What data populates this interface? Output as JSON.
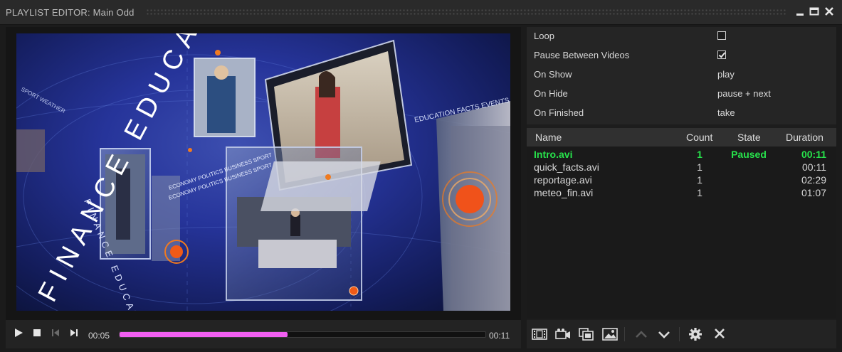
{
  "window": {
    "title": "PLAYLIST EDITOR: Main Odd"
  },
  "video": {
    "overlay_texts": {
      "finance_education": "FINANCE EDUCATION",
      "finance_education_small": "FINANCE EDUCATION F",
      "economy_politics": "ECONOMY POLITICS BUSINESS SPORT",
      "education_facts": "EDUCATION FACTS EVENTS PEOPLE",
      "sport_weather": "SPORT WEATHER"
    }
  },
  "transport": {
    "current_time": "00:05",
    "total_time": "00:11",
    "progress_fraction": 0.46,
    "accent_color": "#f15ff1"
  },
  "properties": [
    {
      "label": "Loop",
      "type": "checkbox",
      "checked": false
    },
    {
      "label": "Pause Between Videos",
      "type": "checkbox",
      "checked": true
    },
    {
      "label": "On Show",
      "type": "text",
      "value": "play"
    },
    {
      "label": "On Hide",
      "type": "text",
      "value": "pause + next"
    },
    {
      "label": "On Finished",
      "type": "text",
      "value": "take"
    }
  ],
  "playlist": {
    "columns": {
      "name": "Name",
      "count": "Count",
      "state": "State",
      "duration": "Duration"
    },
    "active_color": "#27e24b",
    "rows": [
      {
        "name": "Intro.avi",
        "count": "1",
        "state": "Paused",
        "duration": "00:11",
        "active": true
      },
      {
        "name": "quick_facts.avi",
        "count": "1",
        "state": "",
        "duration": "00:11",
        "active": false
      },
      {
        "name": "reportage.avi",
        "count": "1",
        "state": "",
        "duration": "02:29",
        "active": false
      },
      {
        "name": "meteo_fin.avi",
        "count": "1",
        "state": "",
        "duration": "01:07",
        "active": false
      }
    ]
  },
  "toolbar_icons": [
    "add-video-icon",
    "add-camera-icon",
    "add-copy-icon",
    "add-image-icon",
    "move-up-icon",
    "move-down-icon",
    "settings-icon",
    "remove-icon"
  ]
}
